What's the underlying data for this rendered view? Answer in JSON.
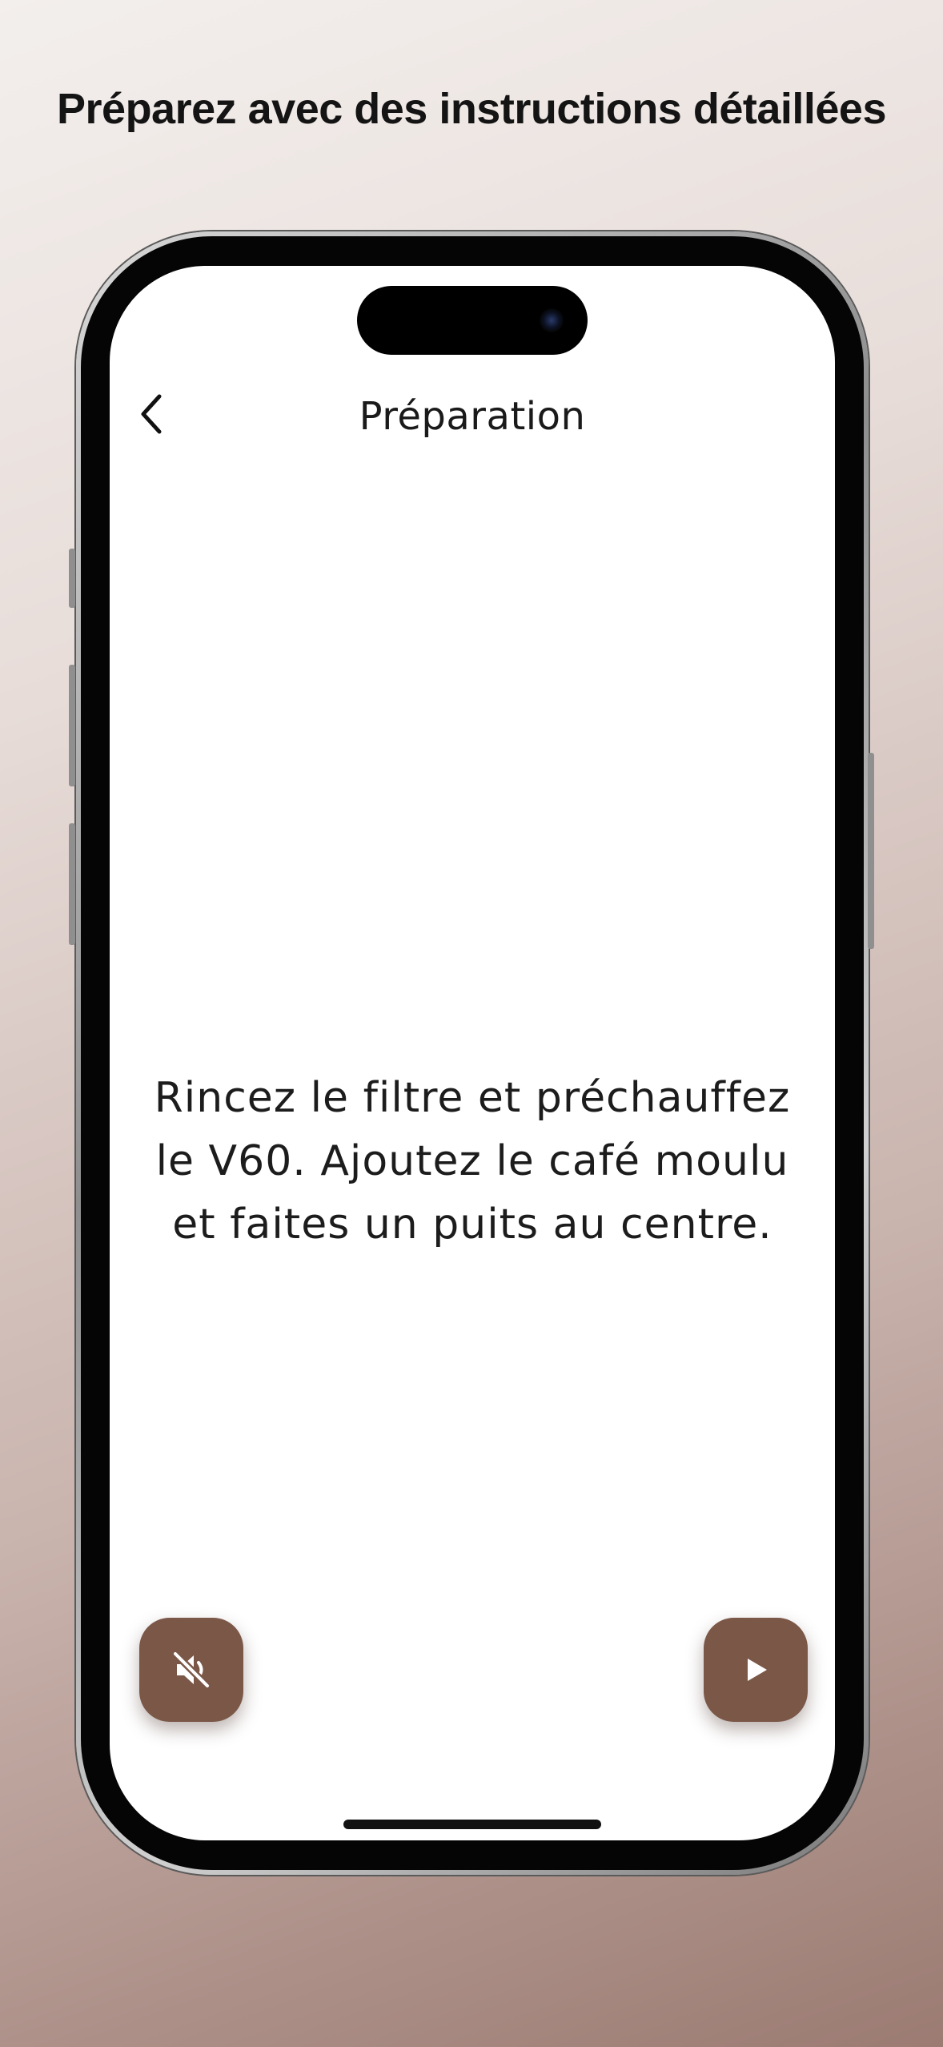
{
  "headline": "Préparez avec des instructions détaillées",
  "screen": {
    "nav": {
      "title": "Préparation",
      "back_icon": "chevron-left-icon"
    },
    "instruction_lines": [
      "Rincez le filtre et préchauffez",
      "le V60. Ajoutez le café moulu",
      "et faites un puits au centre."
    ],
    "controls": {
      "mute_icon": "speaker-muted-icon",
      "play_icon": "play-icon"
    }
  },
  "colors": {
    "accent": "#7b5748",
    "background_top": "#f3efed",
    "background_bottom": "#9b7b72"
  }
}
